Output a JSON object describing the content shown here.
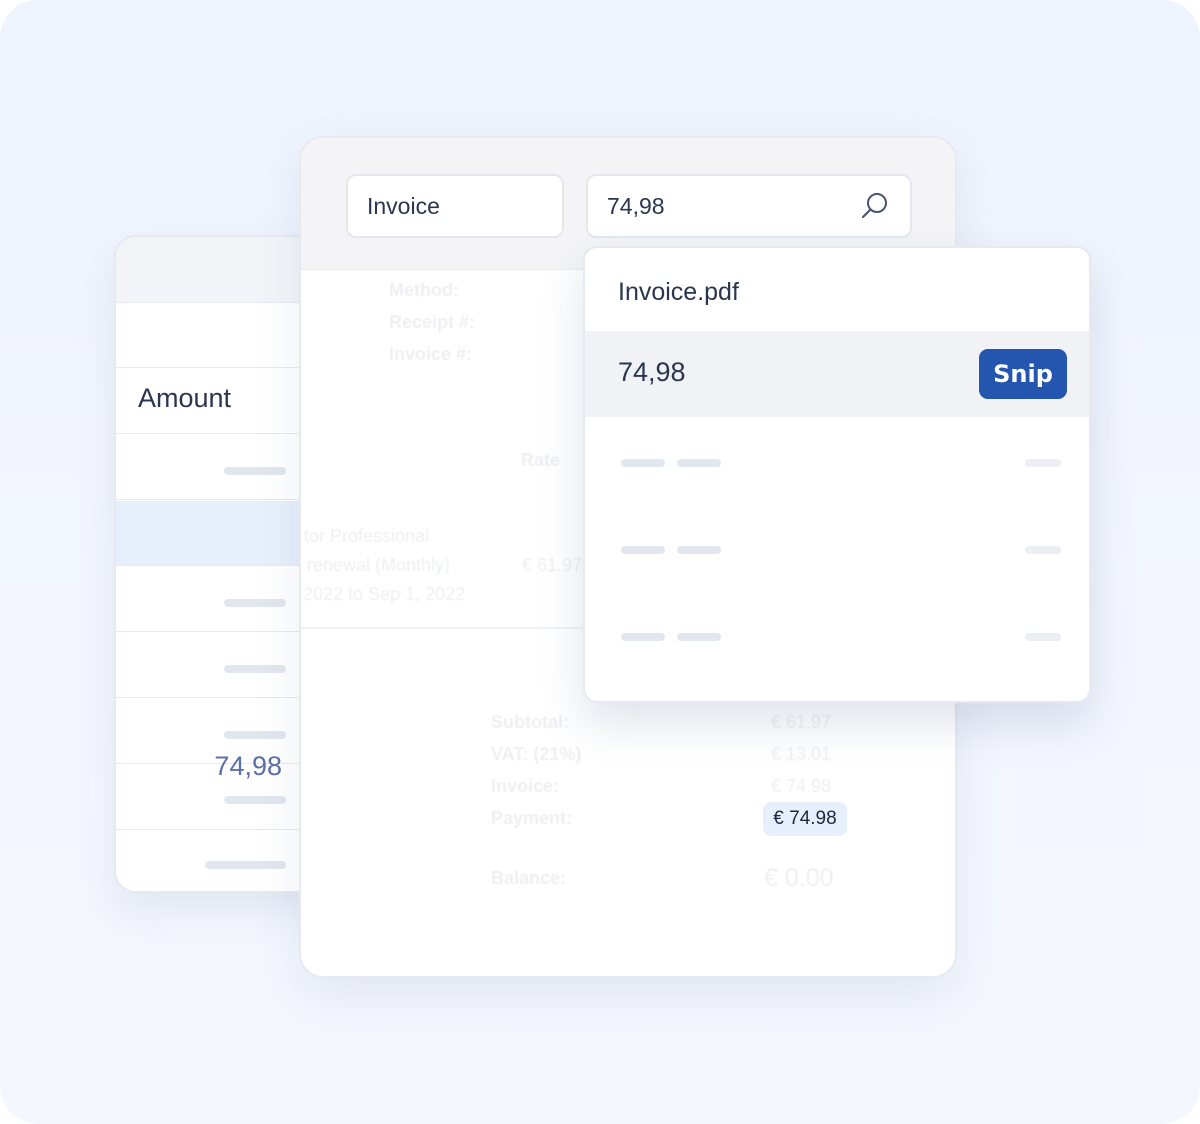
{
  "amount_column": {
    "header": "Amount",
    "highlighted_value": "74,98"
  },
  "search": {
    "document_type_value": "Invoice",
    "amount_value": "74,98"
  },
  "invoice": {
    "labels": {
      "method": "Method:",
      "receipt": "Receipt #:",
      "invoice_no": "Invoice #:",
      "rate": "Rate"
    },
    "line_item": {
      "line1": "tor Professional",
      "line2": "renewal (Monthly)",
      "line3": "2022 to Sep 1, 2022",
      "rate": "€ 61.97"
    },
    "totals": {
      "subtotal_label": "Subtotal:",
      "subtotal_value": "€ 61.97",
      "vat_label": "VAT: (21%)",
      "vat_value": "€ 13.01",
      "invoice_label": "Invoice:",
      "invoice_value": "€ 74.98",
      "payment_label": "Payment:",
      "payment_value": "€ 74.98",
      "balance_label": "Balance:",
      "balance_value": "€ 0.00"
    }
  },
  "results": {
    "file_name": "Invoice.pdf",
    "match_value": "74,98",
    "snip_label": "Snip"
  },
  "colors": {
    "accent": "#2456b0",
    "highlight": "#e8effc",
    "text": "#2b3550",
    "muted_value": "#5c6fa8"
  }
}
